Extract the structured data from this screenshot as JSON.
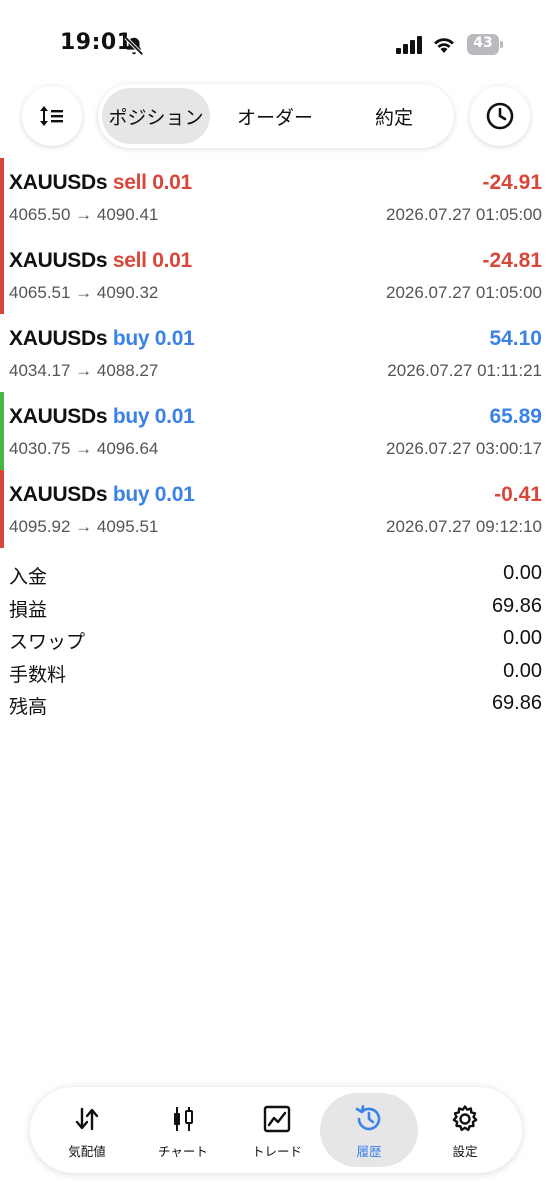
{
  "status_bar": {
    "time": "19:01",
    "battery": "43"
  },
  "header": {
    "tabs": [
      {
        "label": "ポジション",
        "active": true
      },
      {
        "label": "オーダー",
        "active": false
      },
      {
        "label": "約定",
        "active": false
      }
    ],
    "sort_icon": "sort-icon",
    "history_clock_icon": "clock-icon"
  },
  "deals": [
    {
      "symbol": "XAUUSDs",
      "type": "sell",
      "volume": "0.01",
      "prices": "4065.50 → 4090.41",
      "profit": "-24.91",
      "time": "2026.07.27 01:05:00",
      "bar_color": "#d9473b"
    },
    {
      "symbol": "XAUUSDs",
      "type": "sell",
      "volume": "0.01",
      "prices": "4065.51 → 4090.32",
      "profit": "-24.81",
      "time": "2026.07.27 01:05:00",
      "bar_color": "#d9473b"
    },
    {
      "symbol": "XAUUSDs",
      "type": "buy",
      "volume": "0.01",
      "prices": "4034.17 → 4088.27",
      "profit": "54.10",
      "time": "2026.07.27 01:11:21",
      "bar_color": ""
    },
    {
      "symbol": "XAUUSDs",
      "type": "buy",
      "volume": "0.01",
      "prices": "4030.75 → 4096.64",
      "profit": "65.89",
      "time": "2026.07.27 03:00:17",
      "bar_color": "#45b649"
    },
    {
      "symbol": "XAUUSDs",
      "type": "buy",
      "volume": "0.01",
      "prices": "4095.92 → 4095.51",
      "profit": "-0.41",
      "time": "2026.07.27 09:12:10",
      "bar_color": "#d9473b"
    }
  ],
  "summary": [
    {
      "label": "入金",
      "value": "0.00"
    },
    {
      "label": "損益",
      "value": "69.86"
    },
    {
      "label": "スワップ",
      "value": "0.00"
    },
    {
      "label": "手数料",
      "value": "0.00"
    },
    {
      "label": "残高",
      "value": "69.86"
    }
  ],
  "bottom_nav": [
    {
      "label": "気配値",
      "icon": "quotes-icon",
      "active": false
    },
    {
      "label": "チャート",
      "icon": "candlestick-icon",
      "active": false
    },
    {
      "label": "トレード",
      "icon": "trade-chart-icon",
      "active": false
    },
    {
      "label": "履歴",
      "icon": "history-icon",
      "active": true
    },
    {
      "label": "設定",
      "icon": "gear-icon",
      "active": false
    }
  ],
  "colors": {
    "sell": "#d9473b",
    "buy": "#3b82e6",
    "accent": "#3b82e6",
    "active_bg": "#e6e6e9"
  }
}
